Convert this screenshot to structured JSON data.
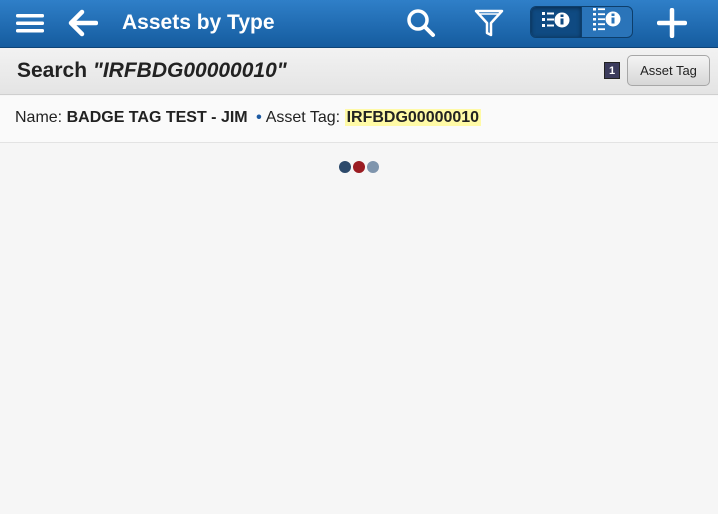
{
  "header": {
    "title": "Assets by Type",
    "icons": [
      "menu-icon",
      "back-arrow-icon",
      "search-icon",
      "filter-icon",
      "list-info-icon",
      "list-info-icon",
      "plus-icon"
    ]
  },
  "search": {
    "label": "Search ",
    "query": "\"IRFBDG00000010\"",
    "count": "1",
    "field_button": "Asset Tag"
  },
  "results": [
    {
      "name_label": "Name:",
      "name_value": "BADGE TAG TEST - JIM",
      "separator": "•",
      "tag_label": "Asset Tag:",
      "tag_value": "IRFBDG00000010"
    }
  ],
  "colors": {
    "header_blue": "#1f6db6",
    "highlight": "#fffaa6",
    "loader_dots": [
      "#2d4a6b",
      "#9b1c22",
      "#7f95ad"
    ]
  }
}
